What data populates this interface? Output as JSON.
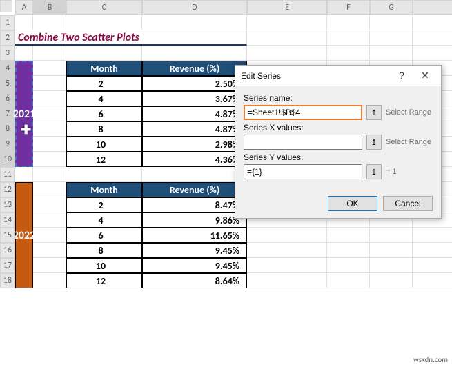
{
  "columns": [
    "A",
    "B",
    "C",
    "D",
    "E",
    "F",
    "G"
  ],
  "rows": [
    "1",
    "2",
    "3",
    "4",
    "5",
    "6",
    "7",
    "8",
    "9",
    "10",
    "11",
    "12",
    "13",
    "14",
    "15",
    "16",
    "17",
    "18"
  ],
  "title": "Combine Two Scatter Plots",
  "t1": {
    "year": "2021",
    "h1": "Month",
    "h2": "Revenue (%)",
    "m": [
      "2",
      "4",
      "6",
      "8",
      "10",
      "12"
    ],
    "r": [
      "2.50%",
      "3.67%",
      "4.87%",
      "4.87%",
      "2.98%",
      "4.36%"
    ]
  },
  "t2": {
    "year": "2022",
    "h1": "Month",
    "h2": "Revenue (%)",
    "m": [
      "2",
      "4",
      "6",
      "8",
      "10",
      "12"
    ],
    "r": [
      "8.47%",
      "9.86%",
      "11.65%",
      "9.45%",
      "9.45%",
      "8.64%"
    ]
  },
  "dialog": {
    "title": "Edit Series",
    "l_name": "Series name:",
    "v_name": "=Sheet1!$B$4",
    "hint_name": "Select Range",
    "l_x": "Series X values:",
    "v_x": "",
    "hint_x": "Select Range",
    "l_y": "Series Y values:",
    "v_y": "={1}",
    "hint_y": "= 1",
    "ok": "OK",
    "cancel": "Cancel",
    "help": "?",
    "close": "✕"
  },
  "icons": {
    "ref": "↥"
  },
  "watermark": "wsxdn.com",
  "chart_data": [
    {
      "type": "table",
      "title": "2021",
      "columns": [
        "Month",
        "Revenue (%)"
      ],
      "rows": [
        [
          "2",
          "2.50%"
        ],
        [
          "4",
          "3.67%"
        ],
        [
          "6",
          "4.87%"
        ],
        [
          "8",
          "4.87%"
        ],
        [
          "10",
          "2.98%"
        ],
        [
          "12",
          "4.36%"
        ]
      ]
    },
    {
      "type": "table",
      "title": "2022",
      "columns": [
        "Month",
        "Revenue (%)"
      ],
      "rows": [
        [
          "2",
          "8.47%"
        ],
        [
          "4",
          "9.86%"
        ],
        [
          "6",
          "11.65%"
        ],
        [
          "8",
          "9.45%"
        ],
        [
          "10",
          "9.45%"
        ],
        [
          "12",
          "8.64%"
        ]
      ]
    }
  ]
}
